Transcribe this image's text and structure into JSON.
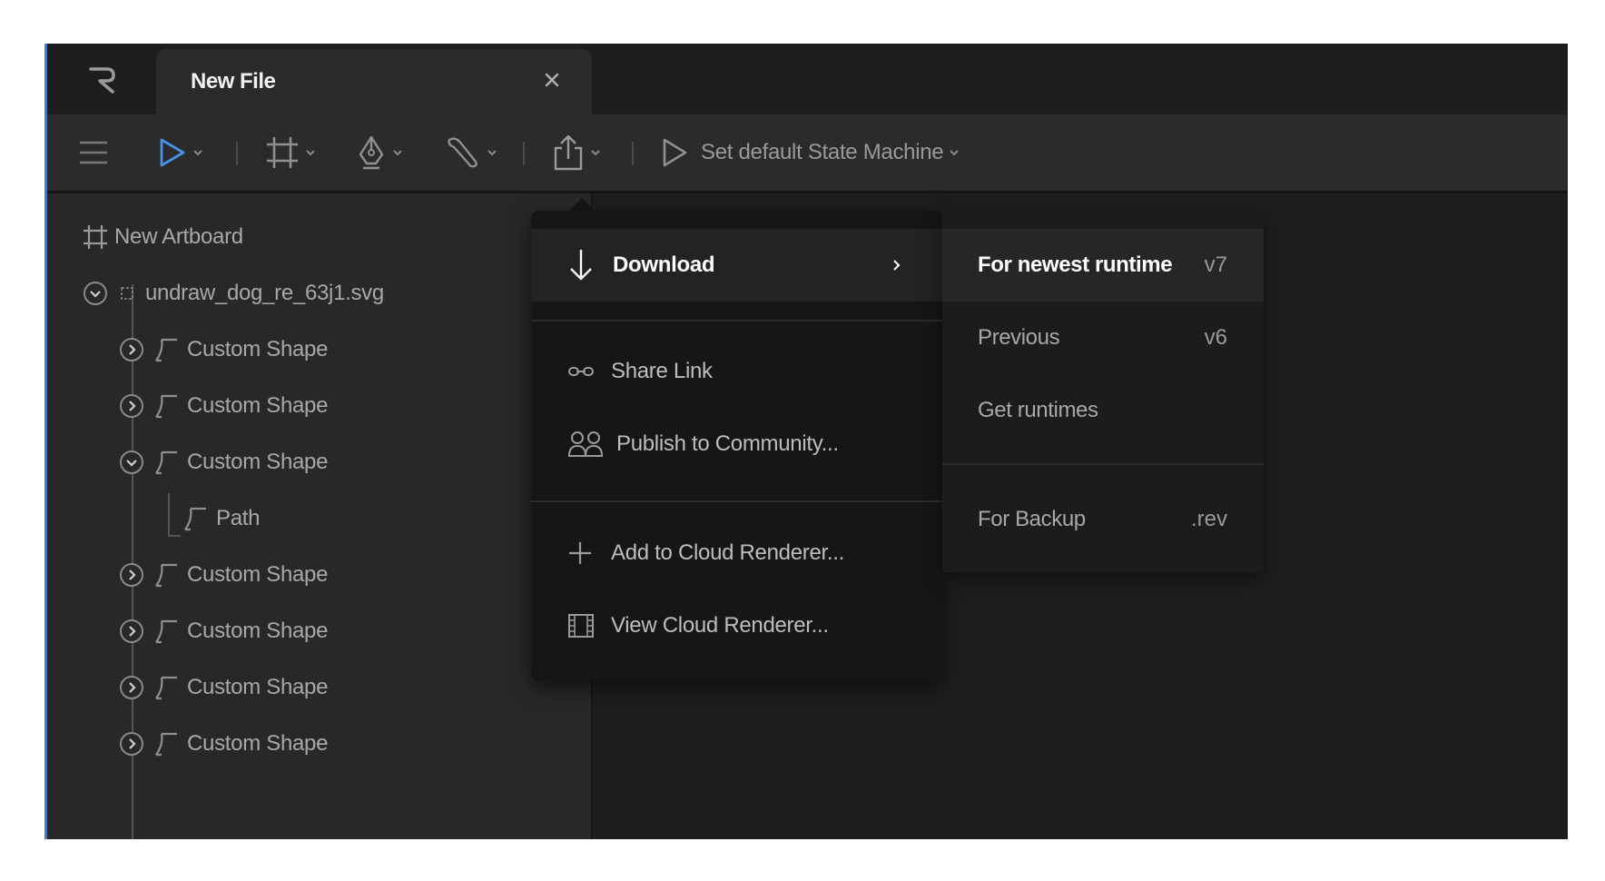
{
  "tab": {
    "title": "New File"
  },
  "toolbar": {
    "state_machine_label": "Set default State Machine"
  },
  "hierarchy": {
    "artboard": "New Artboard",
    "file": "undraw_dog_re_63j1.svg",
    "items": [
      {
        "label": "Custom Shape",
        "expanded": false
      },
      {
        "label": "Custom Shape",
        "expanded": false
      },
      {
        "label": "Custom Shape",
        "expanded": true
      },
      {
        "label": "Path",
        "child": true
      },
      {
        "label": "Custom Shape",
        "expanded": false
      },
      {
        "label": "Custom Shape",
        "expanded": false
      },
      {
        "label": "Custom Shape",
        "expanded": false
      },
      {
        "label": "Custom Shape",
        "expanded": false
      }
    ]
  },
  "export_menu": {
    "download": "Download",
    "share_link": "Share Link",
    "publish": "Publish to Community...",
    "add_cloud": "Add to Cloud Renderer...",
    "view_cloud": "View Cloud Renderer..."
  },
  "download_submenu": {
    "newest": {
      "label": "For newest runtime",
      "value": "v7"
    },
    "previous": {
      "label": "Previous",
      "value": "v6"
    },
    "get_runtimes": {
      "label": "Get runtimes"
    },
    "backup": {
      "label": "For Backup",
      "value": ".rev"
    }
  },
  "colors": {
    "accent": "#2f7ee0",
    "selection_tool": "#4a90e8"
  }
}
